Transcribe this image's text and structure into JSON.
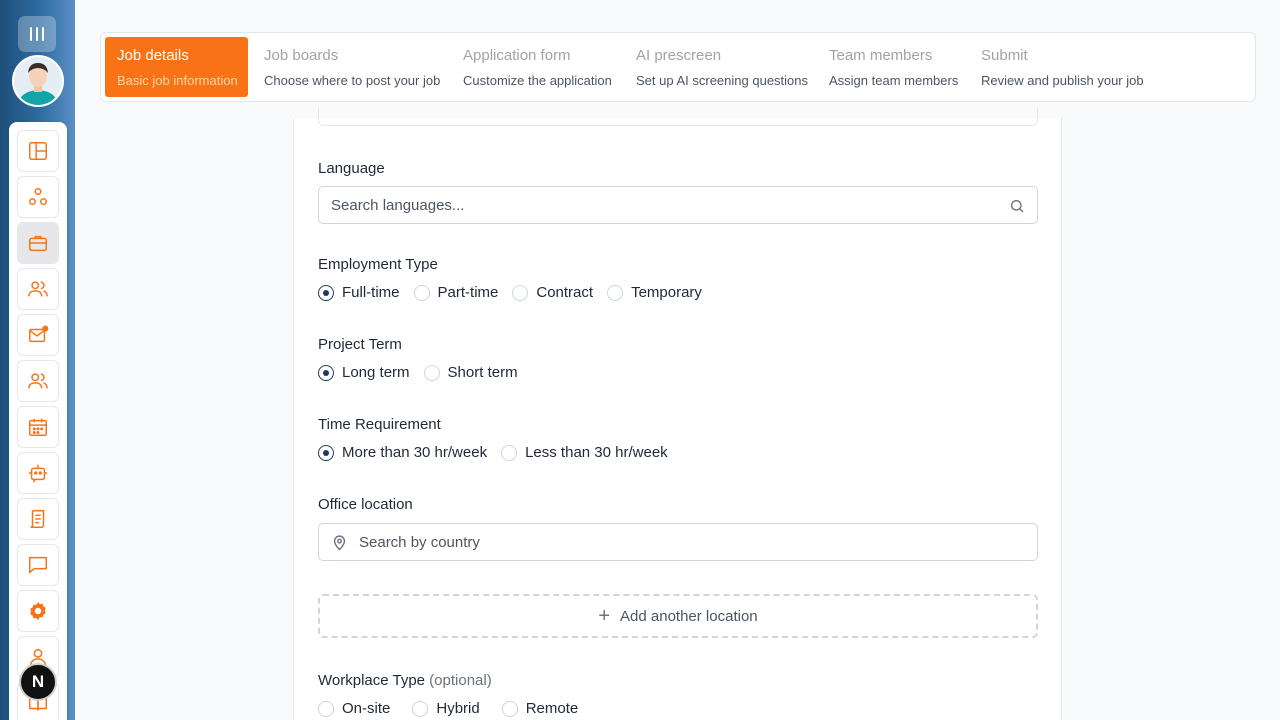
{
  "stepper": {
    "steps": [
      {
        "title": "Job details",
        "desc": "Basic job information"
      },
      {
        "title": "Job boards",
        "desc": "Choose where to post your job"
      },
      {
        "title": "Application form",
        "desc": "Customize the application"
      },
      {
        "title": "AI prescreen",
        "desc": "Set up AI screening questions"
      },
      {
        "title": "Team members",
        "desc": "Assign team members"
      },
      {
        "title": "Submit",
        "desc": "Review and publish your job"
      }
    ]
  },
  "form": {
    "language": {
      "label": "Language",
      "placeholder": "Search languages..."
    },
    "employment": {
      "label": "Employment Type",
      "options": [
        "Full-time",
        "Part-time",
        "Contract",
        "Temporary"
      ],
      "selected": "Full-time"
    },
    "project_term": {
      "label": "Project Term",
      "options": [
        "Long term",
        "Short term"
      ],
      "selected": "Long term"
    },
    "time_req": {
      "label": "Time Requirement",
      "options": [
        "More than 30 hr/week",
        "Less than 30 hr/week"
      ],
      "selected": "More than 30 hr/week"
    },
    "office": {
      "label": "Office location",
      "placeholder": "Search by country",
      "add_label": "Add another location"
    },
    "workplace": {
      "label": "Workplace Type",
      "optional": "(optional)",
      "options": [
        "On-site",
        "Hybrid",
        "Remote"
      ]
    }
  },
  "sidebar": {
    "icons": [
      "dashboard-icon",
      "org-chart-icon",
      "briefcase-icon",
      "candidates-icon",
      "mail-notification-icon",
      "team-icon",
      "calendar-icon",
      "bot-icon",
      "document-icon",
      "chat-icon",
      "settings-icon",
      "user-icon",
      "book-icon"
    ],
    "badge": "N"
  },
  "colors": {
    "accent": "#f97316",
    "radio": "#1e3a5f",
    "rail": "#2f6da3"
  }
}
